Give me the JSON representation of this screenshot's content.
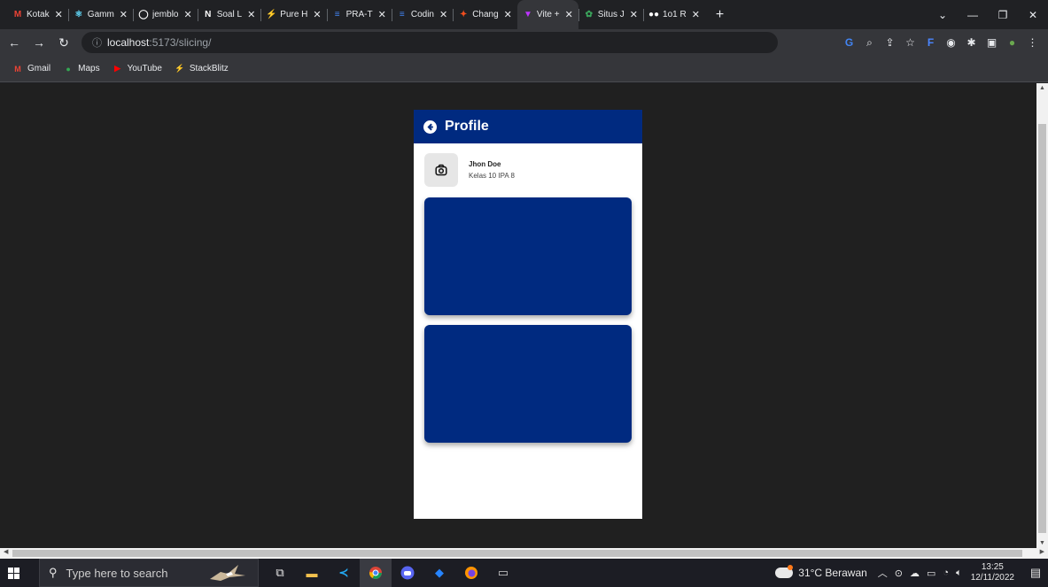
{
  "browser": {
    "tabs": [
      {
        "title": "Kotak",
        "icon": "gmail-icon",
        "color": "#ea4335",
        "glyph": "M"
      },
      {
        "title": "Gamm",
        "icon": "react-icon",
        "color": "#61dafb",
        "glyph": "⚛"
      },
      {
        "title": "jemblo",
        "icon": "github-icon",
        "color": "#ffffff",
        "glyph": "◯"
      },
      {
        "title": "Soal L",
        "icon": "notion-icon",
        "color": "#ffffff",
        "glyph": "N"
      },
      {
        "title": "Pure H",
        "icon": "stackblitz-icon",
        "color": "#1389fd",
        "glyph": "⚡"
      },
      {
        "title": "PRA-T",
        "icon": "docs-icon",
        "color": "#4285f4",
        "glyph": "≡"
      },
      {
        "title": "Codin",
        "icon": "docs-icon",
        "color": "#4285f4",
        "glyph": "≡"
      },
      {
        "title": "Chang",
        "icon": "figma-icon",
        "color": "#f24e1e",
        "glyph": "✦"
      },
      {
        "title": "Vite +",
        "icon": "vite-icon",
        "color": "#bd34fe",
        "glyph": "▼",
        "active": true
      },
      {
        "title": "Situs J",
        "icon": "situs-icon",
        "color": "#3ba55c",
        "glyph": "✿"
      },
      {
        "title": "1o1 R",
        "icon": "dots-icon",
        "color": "#ffffff",
        "glyph": "●●"
      }
    ],
    "new_tab": "+",
    "window_controls": [
      "⌄",
      "—",
      "❐",
      "✕"
    ],
    "url_host": "localhost",
    "url_path": ":5173/slicing/",
    "bookmarks": [
      {
        "label": "Gmail",
        "icon": "gmail-icon",
        "color": "#ea4335",
        "glyph": "M"
      },
      {
        "label": "Maps",
        "icon": "maps-icon",
        "color": "#34a853",
        "glyph": "●"
      },
      {
        "label": "YouTube",
        "icon": "youtube-icon",
        "color": "#ff0000",
        "glyph": "▶"
      },
      {
        "label": "StackBlitz",
        "icon": "stackblitz-icon",
        "color": "#1389fd",
        "glyph": "⚡"
      }
    ]
  },
  "app": {
    "title": "Profile",
    "user_name": "Jhon Doe",
    "user_class": "Kelas 10 IPA 8",
    "brand_color": "#002a80"
  },
  "taskbar": {
    "search_placeholder": "Type here to search",
    "weather": "31°C Berawan",
    "time": "13:25",
    "date": "12/11/2022"
  }
}
